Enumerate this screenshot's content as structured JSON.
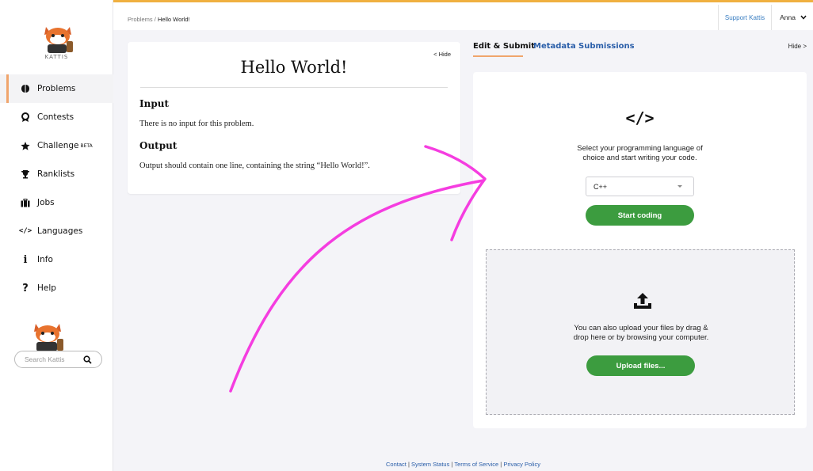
{
  "app": {
    "logo_text": "KATTIS"
  },
  "sidebar": {
    "items": [
      {
        "label": "Problems",
        "icon": "brain-icon",
        "active": true
      },
      {
        "label": "Contests",
        "icon": "medal-icon"
      },
      {
        "label": "Challenge",
        "icon": "star-icon",
        "badge": "BETA"
      },
      {
        "label": "Ranklists",
        "icon": "trophy-icon"
      },
      {
        "label": "Jobs",
        "icon": "briefcase-icon"
      },
      {
        "label": "Languages",
        "icon": "code-icon"
      },
      {
        "label": "Info",
        "icon": "info-icon"
      },
      {
        "label": "Help",
        "icon": "question-icon"
      }
    ],
    "search_placeholder": "Search Kattis"
  },
  "header": {
    "breadcrumb_root": "Problems",
    "breadcrumb_sep": " / ",
    "breadcrumb_current": "Hello World!",
    "support_label": "Support Kattis",
    "user_name": "Anna"
  },
  "problem": {
    "hide_label": "< Hide",
    "title": "Hello World!",
    "input_heading": "Input",
    "input_text": "There is no input for this problem.",
    "output_heading": "Output",
    "output_text": "Output should contain one line, containing the string “Hello World!”."
  },
  "tabs": {
    "items": [
      "Edit & Submit",
      "Metadata",
      "Submissions"
    ],
    "hide_label": "Hide >"
  },
  "submit": {
    "code_symbol": "</>",
    "choose_line1": "Select your programming language of",
    "choose_line2": "choice and start writing your code.",
    "language": "C++",
    "start_label": "Start coding",
    "upload_line1": "You can also upload your files by drag &",
    "upload_line2": "drop here or by browsing your computer.",
    "upload_label": "Upload files..."
  },
  "footer": {
    "links": [
      "Contact",
      "System Status",
      "Terms of Service",
      "Privacy Policy"
    ],
    "sep": " | "
  },
  "colors": {
    "accent_orange": "#f0a56c",
    "top_border": "#f0b040",
    "green": "#3c9c3f",
    "link_blue": "#2a5ea9",
    "annotation_pink": "#f53de0"
  }
}
